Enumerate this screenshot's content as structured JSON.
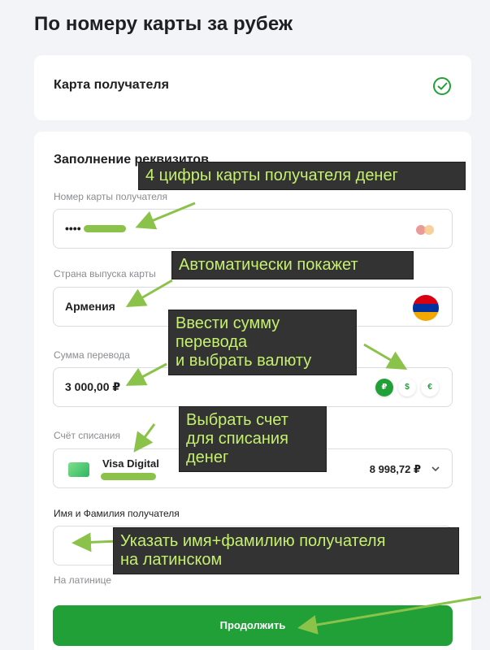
{
  "page": {
    "title": "По номеру карты за рубеж"
  },
  "recipient_card": {
    "label": "Карта получателя"
  },
  "form": {
    "section_title": "Заполнение реквизитов",
    "card_number": {
      "label": "Номер карты получателя",
      "value": "••••"
    },
    "country": {
      "label": "Страна выпуска карты",
      "value": "Армения"
    },
    "amount": {
      "label": "Сумма перевода",
      "value": "3 000,00 ₽"
    },
    "currencies": [
      "₽",
      "$",
      "€"
    ],
    "account": {
      "label": "Счёт списания",
      "card_name": "Visa Digital",
      "balance": "8 998,72 ₽"
    },
    "name": {
      "label": "Имя и Фамилия получателя",
      "value": "",
      "hint": "На латинице"
    },
    "continue_label": "Продолжить"
  },
  "annotations": {
    "card_digits": "4 цифры карты получателя денег",
    "auto_show": "Автоматически покажет",
    "amount_line1": "Ввести сумму",
    "amount_line2": "перевода",
    "amount_line3": "и выбрать валюту",
    "account_line1": "Выбрать счет",
    "account_line2": "для списания",
    "account_line3": "денег",
    "name_line1": "Указать имя+фамилию получателя",
    "name_line2": "на латинском"
  },
  "colors": {
    "accent": "#21a038",
    "annotation_text": "#c5f06f",
    "annotation_bg": "#333333",
    "flag": [
      "#d90012",
      "#0033a0",
      "#f2a800"
    ]
  },
  "icons": {
    "recipient_status": "check-circle-icon",
    "card_brand": "mastercard-icon",
    "country_flag": "armenia-flag-icon",
    "account_card": "card-icon",
    "dropdown": "chevron-down-icon"
  }
}
